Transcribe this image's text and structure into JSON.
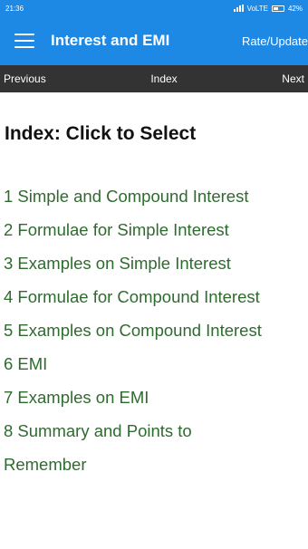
{
  "status": {
    "time": "21:36",
    "network": "VoLTE",
    "battery": "42%"
  },
  "app_bar": {
    "title": "Interest and EMI",
    "action": "Rate/Update",
    "color": "#1e88e5"
  },
  "nav": {
    "previous": "Previous",
    "index": "Index",
    "next": "Next"
  },
  "content": {
    "heading": "Index: Click to Select",
    "items": [
      "1 Simple and Compound Interest",
      "2 Formulae for Simple Interest",
      "3 Examples on Simple Interest",
      "4 Formulae for Compound Interest",
      "5 Examples on Compound Interest",
      "6 EMI",
      "7 Examples on EMI",
      "8 Summary and Points to Remember"
    ],
    "link_color": "#2e6b2e"
  }
}
